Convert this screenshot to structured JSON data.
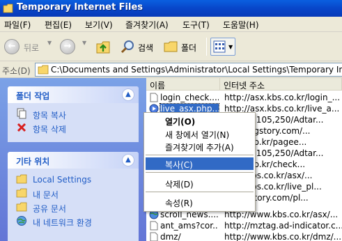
{
  "window": {
    "title": "Temporary Internet Files",
    "icon": "folder-icon"
  },
  "menubar": [
    {
      "label": "파일(F)"
    },
    {
      "label": "편집(E)"
    },
    {
      "label": "보기(V)"
    },
    {
      "label": "즐겨찾기(A)"
    },
    {
      "label": "도구(T)"
    },
    {
      "label": "도움말(H)"
    }
  ],
  "toolbar": {
    "back_label": "뒤로",
    "search_label": "검색",
    "folders_label": "폴더"
  },
  "address": {
    "label": "주소(D)",
    "value": "C:\\Documents and Settings\\Administrator\\Local Settings\\Temporary Internet Files"
  },
  "taskpane": {
    "file_tasks": {
      "title": "폴더 작업",
      "items": [
        {
          "label": "항목 복사",
          "icon": "copy-icon"
        },
        {
          "label": "항목 삭제",
          "icon": "delete-icon"
        }
      ]
    },
    "other_places": {
      "title": "기타 위치",
      "items": [
        {
          "label": "Local Settings",
          "icon": "folder-icon"
        },
        {
          "label": "내 문서",
          "icon": "folder-icon"
        },
        {
          "label": "공유 문서",
          "icon": "folder-icon"
        },
        {
          "label": "내 네트워크 환경",
          "icon": "network-icon"
        }
      ]
    }
  },
  "filelist": {
    "columns": [
      "이름",
      "인터넷 주소"
    ],
    "rows": [
      {
        "name": "login_check....",
        "address": "http://asx.kbs.co.kr/login_..."
      },
      {
        "name": "live_asx.php....",
        "address": "http://asx.kbs.co.kr/live_a...",
        "selected": true
      },
      {
        "name": "",
        "address": "33,233,105,250/Adtar..."
      },
      {
        "name": "",
        "address": "gger.tagstory.com/..."
      },
      {
        "name": "",
        "address": "g.kbs.co.kr/pagee..."
      },
      {
        "name": "",
        "address": "33,233,105,250/Adtar..."
      },
      {
        "name": "",
        "address": "g.kbs.co.kr/check..."
      },
      {
        "name": "",
        "address": "www.kbs.co.kr/asx/..."
      },
      {
        "name": "",
        "address": "www.kbs.co.kr/live_pl..."
      },
      {
        "name": "",
        "address": "ay.tagstory.com/pl..."
      },
      {
        "name": "scroll_news....",
        "address": "http://www.kbs.co.kr/asx/..."
      },
      {
        "name": "ant_ams?cor....",
        "address": "http://mztag.ad-indicator.c..."
      },
      {
        "name": "dmz/",
        "address": "http://www.kbs.co.kr/dmz/..."
      }
    ]
  },
  "context_menu": {
    "items": [
      {
        "label": "열기(O)",
        "bold": true
      },
      {
        "label": "새 창에서 열기(N)"
      },
      {
        "label": "즐겨찾기에 추가(A)"
      },
      {
        "separator": true
      },
      {
        "label": "복사(C)",
        "highlighted": true
      },
      {
        "separator": true
      },
      {
        "label": "삭제(D)"
      },
      {
        "separator": true
      },
      {
        "label": "속성(R)"
      }
    ]
  }
}
